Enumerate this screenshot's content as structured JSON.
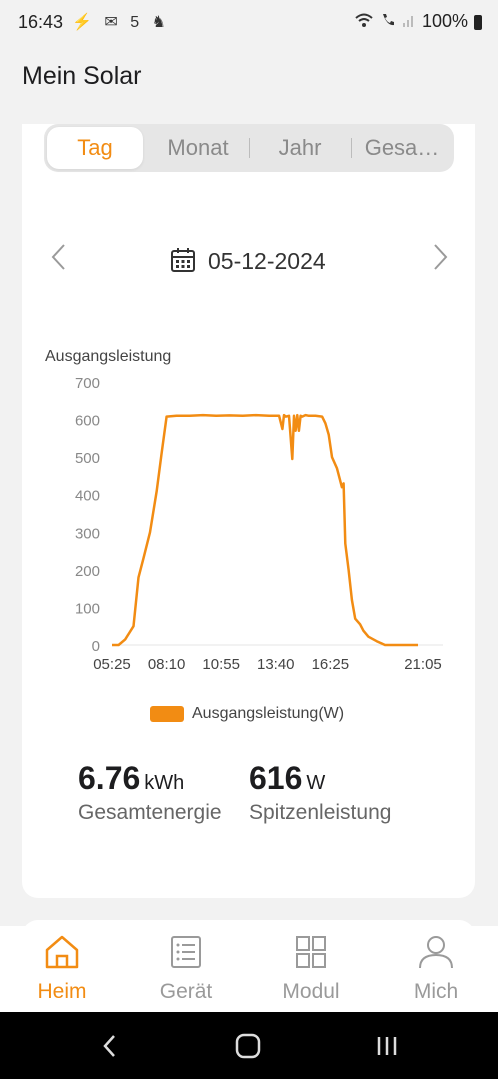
{
  "status_bar": {
    "time": "16:43",
    "notifications": "⚡ ✉ 5 ♞",
    "battery": "100%",
    "icons": [
      "wifi-icon",
      "wifi-call-icon",
      "signal-icon",
      "battery-icon"
    ]
  },
  "header": {
    "title": "Mein Solar"
  },
  "tabs": [
    {
      "label": "Tag",
      "active": true
    },
    {
      "label": "Monat",
      "active": false
    },
    {
      "label": "Jahr",
      "active": false
    },
    {
      "label": "Gesa…",
      "active": false
    }
  ],
  "date_nav": {
    "date": "05-12-2024",
    "icons": [
      "chevron-left-icon",
      "calendar-icon",
      "chevron-right-icon"
    ]
  },
  "chart_data": {
    "type": "line",
    "ylabel": "Ausgangsleistung",
    "ylim": [
      0,
      700
    ],
    "yticks": [
      "700",
      "600",
      "500",
      "400",
      "300",
      "200",
      "100",
      "0"
    ],
    "xticks": [
      "05:25",
      "08:10",
      "10:55",
      "13:40",
      "16:25",
      "21:05"
    ],
    "xlim": [
      "05:25",
      "21:05"
    ],
    "color": "#f28c13",
    "grid": false,
    "legend_position": "bottom",
    "series": [
      {
        "name": "Ausgangsleistung(W)",
        "x": [
          "05:25",
          "05:45",
          "06:05",
          "06:30",
          "06:45",
          "07:00",
          "07:20",
          "07:40",
          "07:55",
          "08:10",
          "08:40",
          "09:20",
          "10:00",
          "10:40",
          "11:20",
          "12:00",
          "12:40",
          "13:20",
          "13:50",
          "14:00",
          "14:05",
          "14:10",
          "14:20",
          "14:30",
          "14:35",
          "14:40",
          "14:45",
          "14:50",
          "14:55",
          "15:00",
          "15:10",
          "15:20",
          "15:40",
          "16:00",
          "16:10",
          "16:20",
          "16:30",
          "16:45",
          "17:00",
          "17:05",
          "17:10",
          "17:20",
          "17:30",
          "17:40",
          "17:55",
          "18:05",
          "18:20",
          "18:45",
          "19:10",
          "19:30",
          "19:50",
          "20:05",
          "20:15",
          "20:30",
          "20:40",
          "20:50"
        ],
        "values": [
          0,
          0,
          15,
          50,
          180,
          230,
          300,
          410,
          510,
          608,
          610,
          610,
          612,
          610,
          611,
          610,
          612,
          610,
          610,
          575,
          612,
          608,
          610,
          495,
          610,
          570,
          612,
          570,
          610,
          608,
          612,
          610,
          610,
          608,
          590,
          560,
          500,
          470,
          420,
          430,
          270,
          200,
          120,
          70,
          55,
          38,
          22,
          10,
          0,
          0,
          0,
          0,
          0,
          0,
          0,
          0
        ]
      }
    ]
  },
  "legend": {
    "label": "Ausgangsleistung(W)"
  },
  "stats": [
    {
      "value": "6.76",
      "unit": "kWh",
      "label": "Gesamtenergie"
    },
    {
      "value": "616",
      "unit": "W",
      "label": "Spitzenleistung"
    }
  ],
  "bottom_nav": [
    {
      "label": "Heim",
      "icon": "home-icon",
      "active": true
    },
    {
      "label": "Gerät",
      "icon": "list-icon",
      "active": false
    },
    {
      "label": "Modul",
      "icon": "grid-icon",
      "active": false
    },
    {
      "label": "Mich",
      "icon": "person-icon",
      "active": false
    }
  ],
  "colors": {
    "accent": "#f28c13",
    "inactive": "#9a9a9a",
    "background": "#f2f2f2"
  }
}
